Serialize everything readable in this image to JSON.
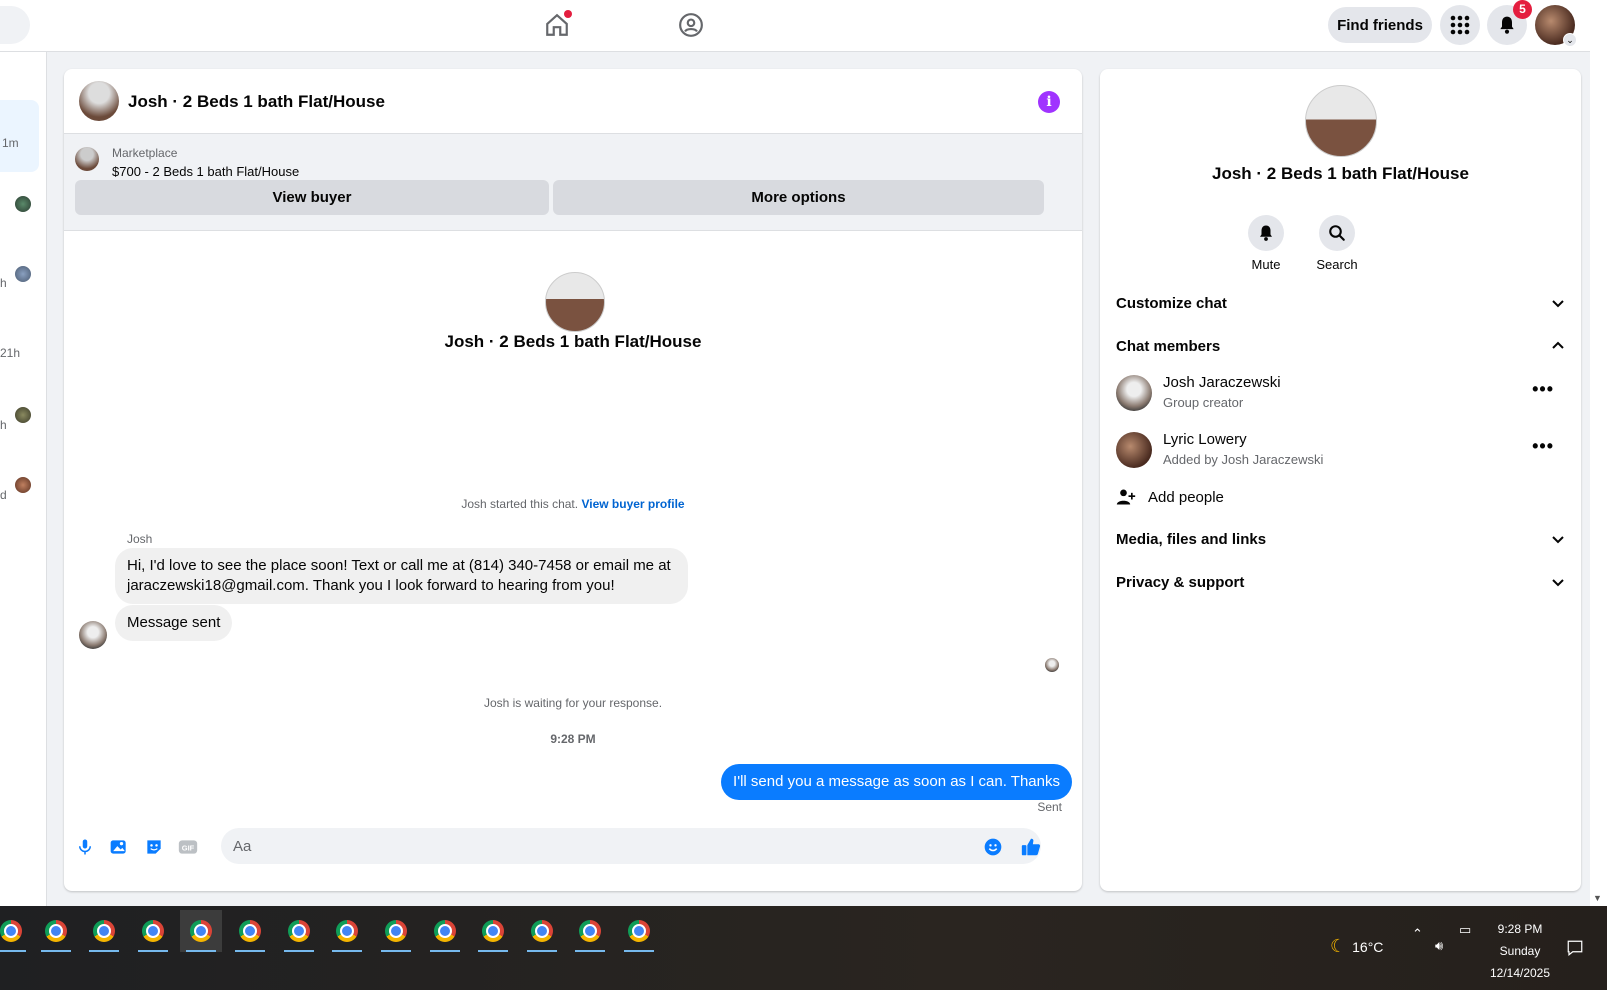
{
  "topbar": {
    "find_friends": "Find friends",
    "notifications_count": "5",
    "icons": [
      "home-icon",
      "groups-icon",
      "menu-grid-icon",
      "bell-icon"
    ]
  },
  "left_strip": {
    "times": [
      "1m",
      "h",
      "h",
      "21h",
      "h",
      "d"
    ]
  },
  "chat": {
    "header_title": "Josh · 2 Beds 1 bath Flat/House",
    "marketplace_label": "Marketplace",
    "listing": "$700 - 2 Beds 1 bath Flat/House",
    "view_buyer": "View buyer",
    "more_options": "More options",
    "intro_title": "Josh · 2 Beds 1 bath Flat/House",
    "started_text": "Josh started this chat.",
    "started_link": "View buyer profile",
    "sender_name": "Josh",
    "message_1": "Hi, I'd love to see the place soon! Text or call me at (814) 340-7458 or email me at jaraczewski18@gmail.com. Thank you I look forward to hearing from you!",
    "message_2": "Message sent",
    "waiting": "Josh is waiting for your response.",
    "timestamp": "9:28 PM",
    "outgoing": "I'll send you a message as soon as I can. Thanks",
    "sent_label": "Sent",
    "composer_placeholder": "Aa"
  },
  "info": {
    "title": "Josh · 2 Beds 1 bath Flat/House",
    "mute": "Mute",
    "search": "Search",
    "customize_chat": "Customize chat",
    "chat_members": "Chat members",
    "members": [
      {
        "name": "Josh Jaraczewski",
        "sub": "Group creator"
      },
      {
        "name": "Lyric Lowery",
        "sub": "Added by Josh Jaraczewski"
      }
    ],
    "add_people": "Add people",
    "media": "Media, files and links",
    "privacy": "Privacy & support"
  },
  "taskbar": {
    "temperature": "16°C",
    "time": "9:28 PM",
    "day": "Sunday",
    "date": "12/14/2025"
  },
  "colors": {
    "accent_blue": "#0a7cff",
    "link_blue": "#0064d1",
    "info_purple": "#a033ff",
    "badge_red": "#e41e3f"
  }
}
